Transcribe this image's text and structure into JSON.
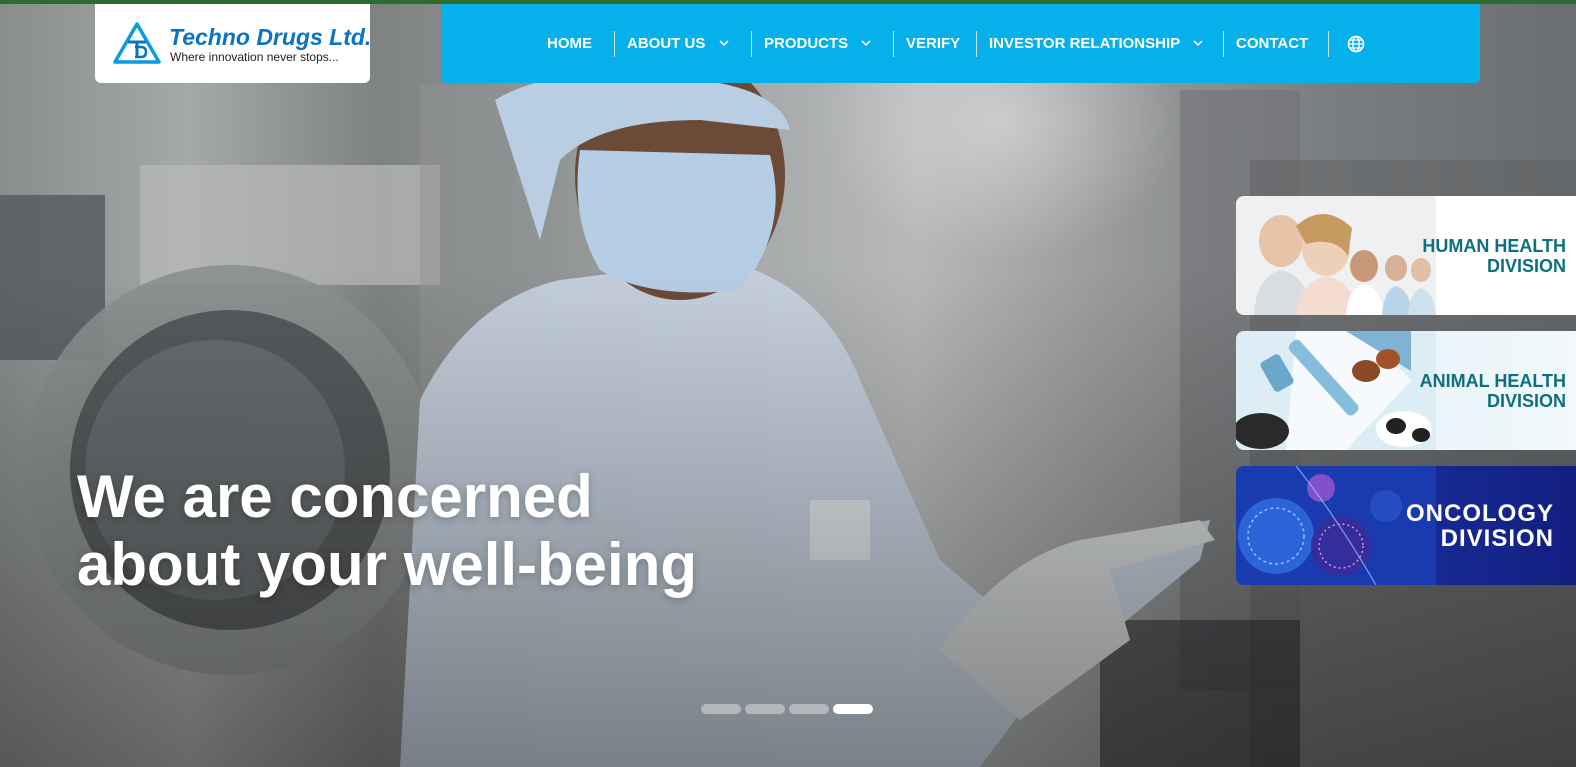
{
  "brand": {
    "name": "Techno Drugs Ltd.",
    "tagline": "Where innovation never stops...",
    "logo_icon": "triangle-td-logo-icon"
  },
  "nav": {
    "items": [
      {
        "label": "HOME",
        "has_dropdown": false
      },
      {
        "label": "ABOUT US",
        "has_dropdown": true
      },
      {
        "label": "PRODUCTS",
        "has_dropdown": true
      },
      {
        "label": "VERIFY",
        "has_dropdown": false
      },
      {
        "label": "INVESTOR RELATIONSHIP",
        "has_dropdown": true
      },
      {
        "label": "CONTACT",
        "has_dropdown": false
      }
    ],
    "language_icon": "globe-icon",
    "dropdown_icon": "chevron-down-icon"
  },
  "hero": {
    "headline_line1": "We are concerned",
    "headline_line2": "about your well-being",
    "slide_count": 4,
    "active_slide": 4
  },
  "divisions": [
    {
      "line1": "HUMAN HEALTH",
      "line2": "DIVISION"
    },
    {
      "line1": "ANIMAL HEALTH",
      "line2": "DIVISION"
    },
    {
      "line1": "ONCOLOGY",
      "line2": "DIVISION"
    }
  ],
  "colors": {
    "nav_background": "#06b0ea",
    "top_line": "#2e6b2e",
    "brand_blue": "#0a73c4",
    "division_text": "#0e6f7d",
    "oncology_background": "#162a94"
  }
}
